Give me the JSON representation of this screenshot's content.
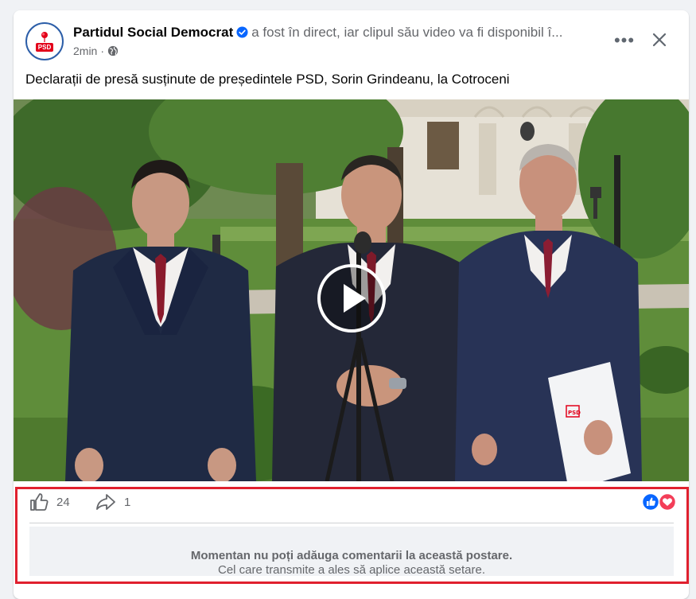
{
  "post": {
    "page_name": "Partidul Social Democrat",
    "live_text": "a fost în direct, iar clipul său video va fi disponibil î...",
    "time": "2min",
    "separator": "·",
    "avatar_text": "PSD",
    "more_label": "•••",
    "text": "Declarații de presă susținute de președintele PSD, Sorin Grindeanu, la Cotroceni"
  },
  "video": {
    "folder_label": "PSD"
  },
  "actions": {
    "like_count": "24",
    "share_count": "1",
    "reactions": [
      "like-reaction-icon",
      "love-reaction-icon"
    ]
  },
  "comments": {
    "disabled_title": "Momentan nu poți adăuga comentarii la această postare.",
    "disabled_subtitle": "Cel care transmite a ales să aplice această setare."
  },
  "colors": {
    "brand_blue": "#0866ff",
    "psd_red": "#e2001a",
    "love_red": "#f33e58",
    "highlight_red": "#e0202e",
    "muted_text": "#65676b"
  }
}
